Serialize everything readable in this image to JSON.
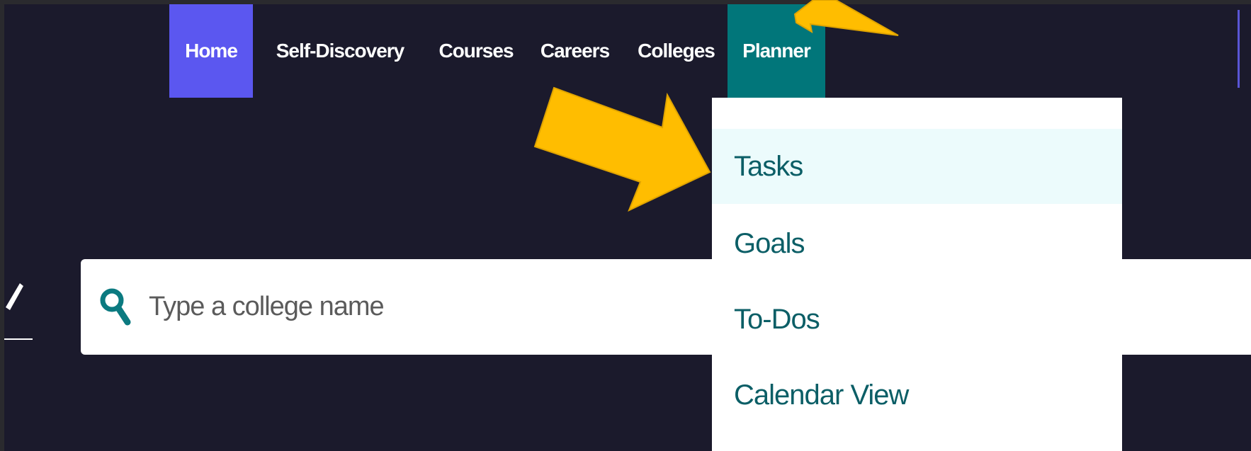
{
  "nav": {
    "items": [
      {
        "label": "Home"
      },
      {
        "label": "Self-Discovery"
      },
      {
        "label": "Courses"
      },
      {
        "label": "Careers"
      },
      {
        "label": "Colleges"
      },
      {
        "label": "Planner"
      }
    ],
    "active": "Home",
    "open_menu": "Planner"
  },
  "planner_menu": {
    "items": [
      {
        "label": "Tasks",
        "highlighted": true
      },
      {
        "label": "Goals"
      },
      {
        "label": "To-Dos"
      },
      {
        "label": "Calendar View"
      }
    ]
  },
  "search": {
    "placeholder": "Type a college name",
    "value": "",
    "icon": "search-icon"
  },
  "annotations": {
    "arrow_color": "#ffbd00",
    "arrow_count": 2
  },
  "colors": {
    "background": "#1b1a2c",
    "home_active": "#5b57f0",
    "planner_active": "#01767a",
    "menu_text": "#0b5e66",
    "menu_highlight": "#ecfbfc"
  }
}
